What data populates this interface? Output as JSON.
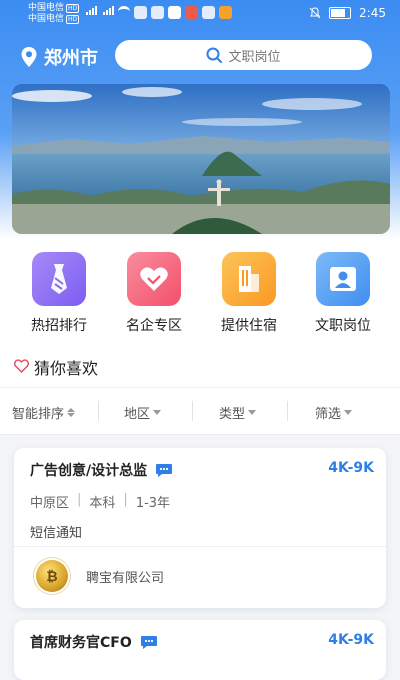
{
  "status_bar": {
    "carrier1": "中国电信",
    "carrier2": "中国电信",
    "hd": "HD",
    "time": "2:45"
  },
  "header": {
    "city": "郑州市",
    "search_placeholder": "文职岗位"
  },
  "quick_links": [
    {
      "label": "热招排行",
      "icon": "necktie-icon"
    },
    {
      "label": "名企专区",
      "icon": "handshake-heart-icon"
    },
    {
      "label": "提供住宿",
      "icon": "building-icon"
    },
    {
      "label": "文职岗位",
      "icon": "person-badge-icon"
    }
  ],
  "guess": {
    "label": "猜你喜欢",
    "icon": "heart-outline-icon"
  },
  "filters": [
    {
      "label": "智能排序"
    },
    {
      "label": "地区"
    },
    {
      "label": "类型"
    },
    {
      "label": "筛选"
    }
  ],
  "jobs": [
    {
      "title": "广告创意/设计总监",
      "salary": "4K-9K",
      "district": "中原区",
      "education": "本科",
      "experience": "1-3年",
      "notice": "短信通知",
      "company": "聘宝有限公司",
      "logo_char": "₿"
    },
    {
      "title": "首席财务官CFO",
      "salary": "4K-9K"
    }
  ],
  "colors": {
    "accent": "#2f7fe6",
    "header_blue": "#3b8cf2"
  }
}
